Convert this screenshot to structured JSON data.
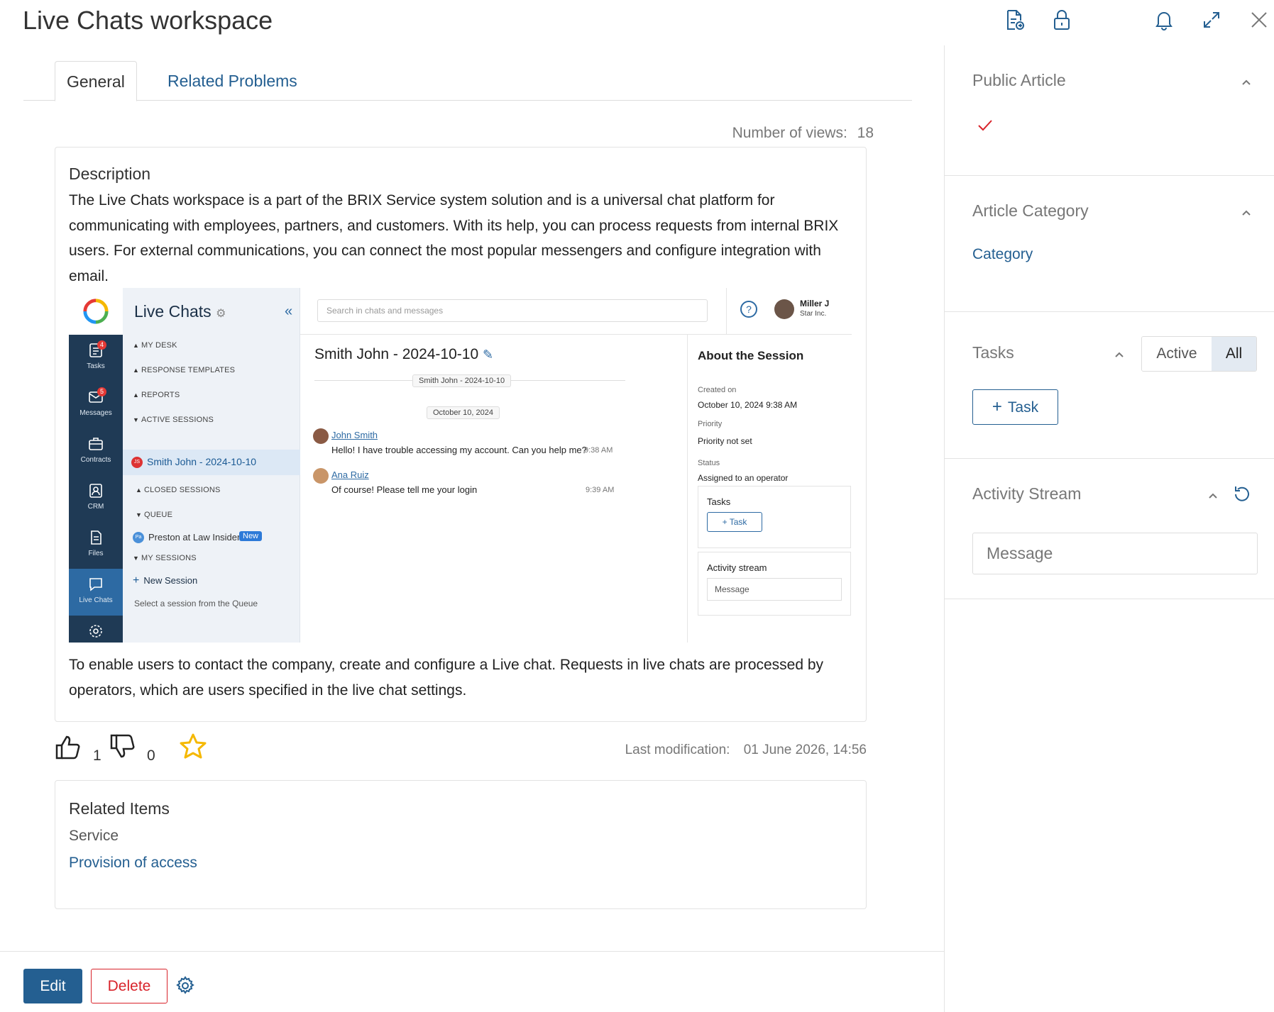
{
  "header": {
    "title": "Live Chats workspace"
  },
  "tabs": [
    {
      "label": "General"
    },
    {
      "label": "Related Problems"
    }
  ],
  "views": {
    "label": "Number of views:",
    "count": "18"
  },
  "description": {
    "heading": "Description",
    "paragraph1": "The Live Chats workspace is a part of the BRIX Service system solution and is a universal chat platform for communicating with employees, partners, and customers. With its help, you can process requests from internal BRIX users. For external communications, you can connect the most popular messengers and configure integration with email.",
    "paragraph2": "To enable users to contact the company, create and configure a Live chat. Requests in live chats are processed by operators, which are users specified in the live chat settings."
  },
  "embedded": {
    "app_title": "Live Chats",
    "search_placeholder": "Search in chats and messages",
    "user_name": "Miller J",
    "user_company": "Star Inc.",
    "nav": [
      {
        "label": "Tasks",
        "badge": "4"
      },
      {
        "label": "Messages",
        "badge": "5"
      },
      {
        "label": "Contracts"
      },
      {
        "label": "CRM"
      },
      {
        "label": "Files"
      },
      {
        "label": "Live Chats"
      }
    ],
    "sidebar": {
      "my_desk": "MY DESK",
      "response_templates": "RESPONSE TEMPLATES",
      "reports": "REPORTS",
      "active_sessions": "ACTIVE SESSIONS",
      "active_item": "Smith John - 2024-10-10",
      "active_initials": "JS",
      "closed_sessions": "CLOSED SESSIONS",
      "queue": "QUEUE",
      "queue_item": "Preston at Law Insider -",
      "queue_initials": "Pa",
      "queue_badge": "New",
      "my_sessions": "MY SESSIONS",
      "new_session": "New Session",
      "hint": "Select a session from the Queue"
    },
    "chat": {
      "title": "Smith John - 2024-10-10",
      "session_pill": "Smith John - 2024-10-10",
      "date_pill": "October 10, 2024",
      "messages": [
        {
          "name": "John Smith",
          "text": "Hello! I have trouble accessing my account. Can you help me?",
          "time": "9:38 AM"
        },
        {
          "name": "Ana Ruiz",
          "text": "Of course! Please tell me your login",
          "time": "9:39 AM"
        }
      ]
    },
    "about": {
      "title": "About the Session",
      "created_label": "Created on",
      "created_value": "October 10, 2024 9:38 AM",
      "priority_label": "Priority",
      "priority_value": "Priority not set",
      "status_label": "Status",
      "status_value": "Assigned to an operator",
      "tasks_label": "Tasks",
      "task_button": "Task",
      "activity_label": "Activity stream",
      "message_placeholder": "Message"
    }
  },
  "rating": {
    "likes": "1",
    "dislikes": "0"
  },
  "last_modification": {
    "label": "Last modification:",
    "value": "01 June 2026, 14:56"
  },
  "related": {
    "heading": "Related Items",
    "group": "Service",
    "link": "Provision of access"
  },
  "actions": {
    "edit": "Edit",
    "delete": "Delete"
  },
  "right_panel": {
    "public_article": {
      "title": "Public Article"
    },
    "article_category": {
      "title": "Article Category",
      "value": "Category"
    },
    "tasks": {
      "title": "Tasks",
      "filter_active": "Active",
      "filter_all": "All",
      "add_button": "Task"
    },
    "activity_stream": {
      "title": "Activity Stream",
      "message_placeholder": "Message"
    }
  },
  "colors": {
    "accent": "#245f91",
    "danger": "#d8232a",
    "star": "#f5b800",
    "check": "#d8232a"
  }
}
